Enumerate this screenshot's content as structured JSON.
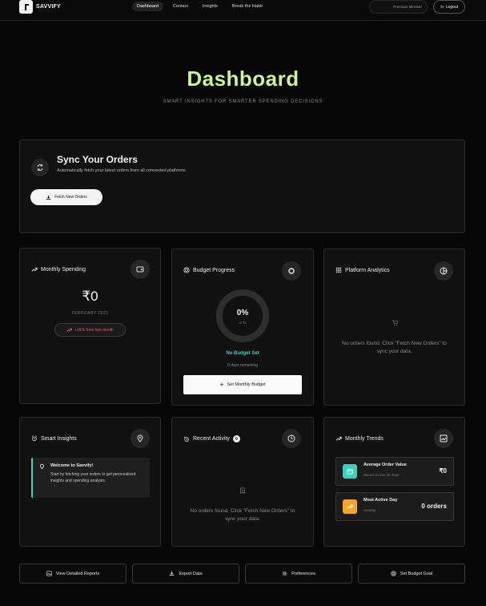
{
  "brand": {
    "name": "SAVVIFY"
  },
  "nav": {
    "links": [
      {
        "label": "Dashboard",
        "active": true
      },
      {
        "label": "Contact"
      },
      {
        "label": "Insights"
      },
      {
        "label": "Break the Habit"
      }
    ],
    "premium_label": "Premium Member",
    "logout_label": "Logout"
  },
  "hero": {
    "title": "Dashboard",
    "subtitle": "SMART INSIGHTS FOR SMARTER SPENDING DECISIONS"
  },
  "sync": {
    "title": "Sync Your Orders",
    "description": "Automatically fetch your latest orders from all connected platforms",
    "button_label": "Fetch New Orders"
  },
  "monthly_spending": {
    "title": "Monthly Spending",
    "amount": "₹0",
    "month": "FEBRUARY 2025",
    "change": "+18% from last month"
  },
  "budget_progress": {
    "title": "Budget Progress",
    "percent_label": "0%",
    "percent": 0,
    "of_label": "of ₹0",
    "status": "No Budget Set",
    "days_remaining": "0 days remaining",
    "button_label": "Set Monthly Budget"
  },
  "platform_analytics": {
    "title": "Platform Analytics",
    "empty_text": "No orders found. Click \"Fetch New Orders\" to sync your data."
  },
  "smart_insights": {
    "title": "Smart Insights",
    "welcome_title": "Welcome to Savvify!",
    "welcome_text": "Start by fetching your orders to get personalized insights and spending analysis."
  },
  "recent_activity": {
    "title": "Recent Activity",
    "count": "0",
    "empty_text": "No orders found. Click \"Fetch New Orders\" to sync your data."
  },
  "monthly_trends": {
    "title": "Monthly Trends",
    "items": [
      {
        "label": "Average Order Value",
        "sub": "Based on last 30 days",
        "value": "₹0",
        "color": "#3fcfc0"
      },
      {
        "label": "Most Active Day",
        "sub": "Sunday",
        "value": "0 orders",
        "color": "#f5a623"
      }
    ]
  },
  "footer_actions": [
    {
      "label": "View Detailed Reports",
      "icon": "image-icon"
    },
    {
      "label": "Export Data",
      "icon": "download-icon"
    },
    {
      "label": "Preferences",
      "icon": "gear-icon"
    },
    {
      "label": "Set Budget Goal",
      "icon": "target-icon"
    }
  ],
  "colors": {
    "accent": "#cdf58f",
    "teal": "#3fcfc0",
    "negative": "#ee5959",
    "orange": "#f5a623"
  }
}
